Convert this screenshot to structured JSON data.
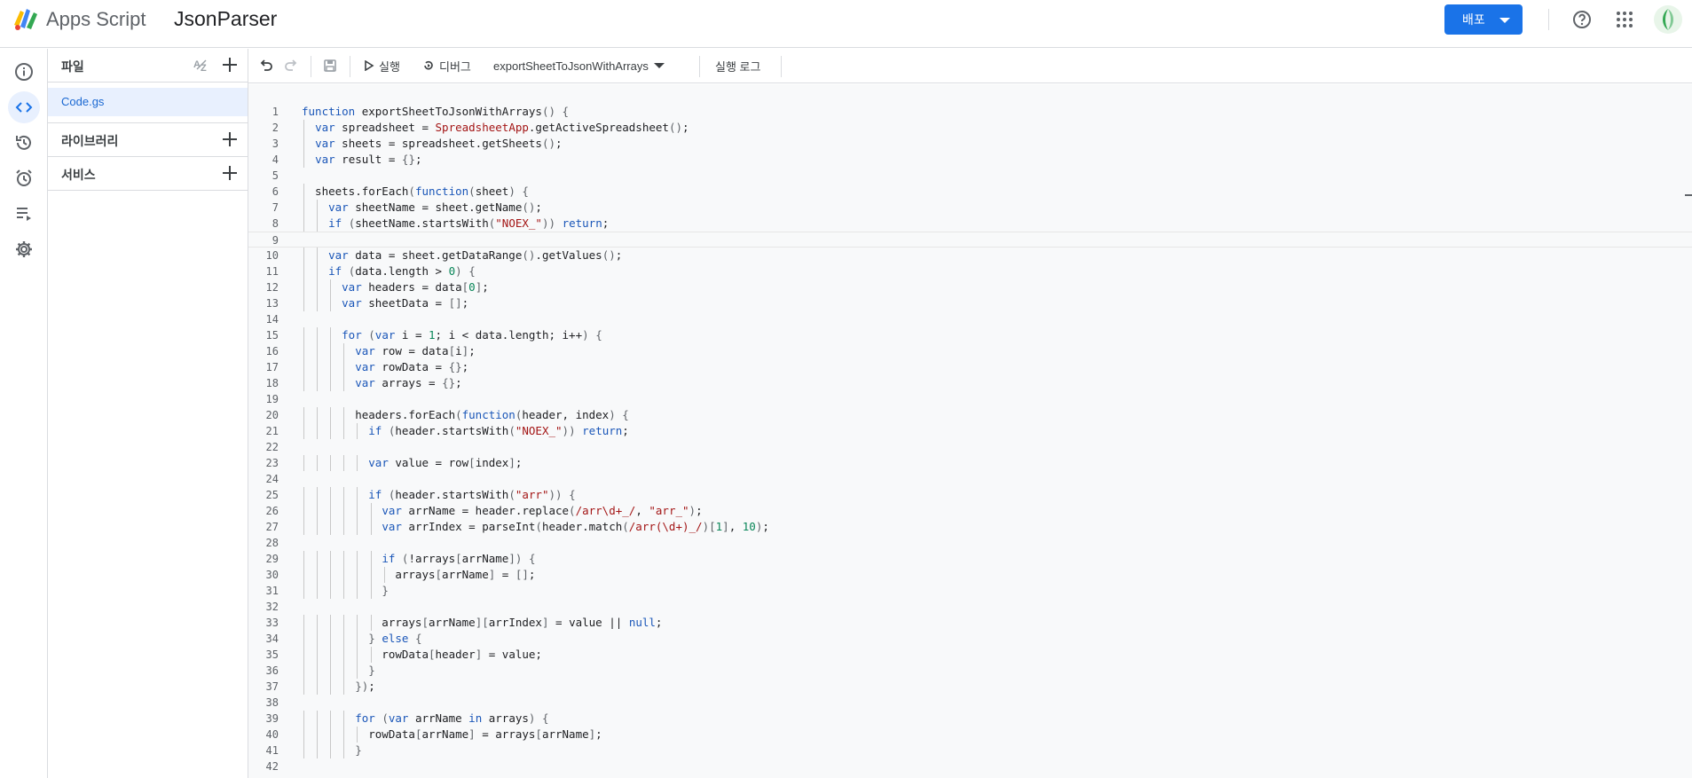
{
  "header": {
    "brand": "Apps Script",
    "project_title": "JsonParser",
    "deploy_label": "배포",
    "accent": "#1a73e8"
  },
  "rail": {
    "icons": [
      "info-icon",
      "code-icon",
      "history-icon",
      "alarm-icon",
      "executions-icon",
      "settings-icon"
    ],
    "active": "code-icon"
  },
  "files": {
    "header": "파일",
    "items": [
      "Code.gs"
    ],
    "libraries_label": "라이브러리",
    "services_label": "서비스"
  },
  "toolbar": {
    "run_label": "실행",
    "debug_label": "디버그",
    "function_name": "exportSheetToJsonWithArrays",
    "log_label": "실행 로그"
  },
  "code": {
    "current_line": 9,
    "lines": [
      "function exportSheetToJsonWithArrays() {",
      "  var spreadsheet = SpreadsheetApp.getActiveSpreadsheet();",
      "  var sheets = spreadsheet.getSheets();",
      "  var result = {};",
      "",
      "  sheets.forEach(function(sheet) {",
      "    var sheetName = sheet.getName();",
      "    if (sheetName.startsWith(\"NOEX_\")) return;",
      "",
      "    var data = sheet.getDataRange().getValues();",
      "    if (data.length > 0) {",
      "      var headers = data[0];",
      "      var sheetData = [];",
      "",
      "      for (var i = 1; i < data.length; i++) {",
      "        var row = data[i];",
      "        var rowData = {};",
      "        var arrays = {};",
      "",
      "        headers.forEach(function(header, index) {",
      "          if (header.startsWith(\"NOEX_\")) return;",
      "",
      "          var value = row[index];",
      "",
      "          if (header.startsWith(\"arr\")) {",
      "            var arrName = header.replace(/arr\\d+_/, \"arr_\");",
      "            var arrIndex = parseInt(header.match(/arr(\\d+)_/)[1], 10);",
      "",
      "            if (!arrays[arrName]) {",
      "              arrays[arrName] = [];",
      "            }",
      "",
      "            arrays[arrName][arrIndex] = value || null;",
      "          } else {",
      "            rowData[header] = value;",
      "          }",
      "        });",
      "",
      "        for (var arrName in arrays) {",
      "          rowData[arrName] = arrays[arrName];",
      "        }",
      ""
    ]
  }
}
